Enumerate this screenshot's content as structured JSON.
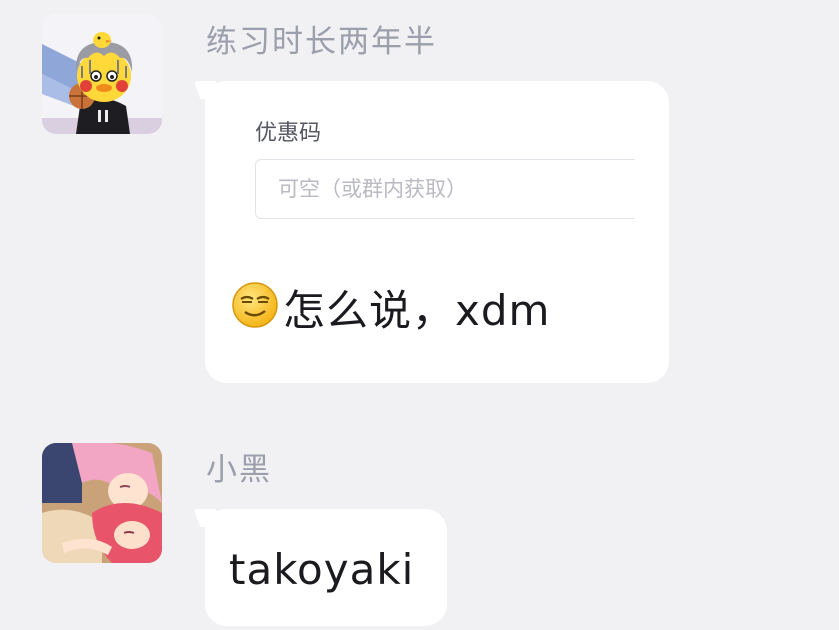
{
  "messages": [
    {
      "sender": "练习时长两年半",
      "avatar": "duck-basketball-avatar",
      "embed": {
        "label": "优惠码",
        "input_value": "",
        "input_placeholder": "可空（或群内获取）"
      },
      "text": "怎么说，xdm",
      "emoji": "smirk-face-emoji"
    },
    {
      "sender": "小黑",
      "avatar": "anime-pink-hair-avatar",
      "text": "takoyaki"
    }
  ],
  "colors": {
    "background": "#f1f1f4",
    "bubble": "#ffffff",
    "sender_name": "#9b9eab",
    "message_text": "#1a1a1f",
    "input_border": "#e2e3e8",
    "placeholder": "#b9bac2"
  }
}
